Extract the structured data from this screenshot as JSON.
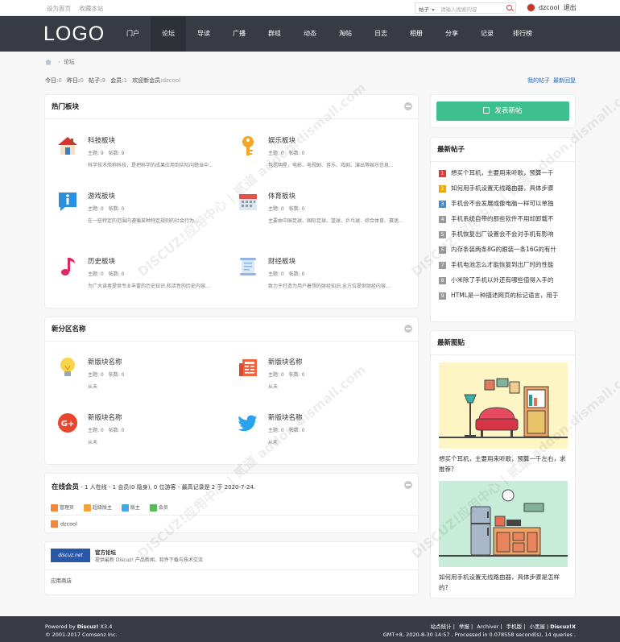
{
  "topbar": {
    "set_home": "设为首页",
    "bookmark": "收藏本站"
  },
  "search": {
    "scope": "帖子",
    "placeholder": "请输入搜索内容"
  },
  "user": {
    "name": "dzcool",
    "logout": "退出"
  },
  "logo": "LOGO",
  "nav": [
    "门户",
    "论坛",
    "导读",
    "广播",
    "群组",
    "动态",
    "淘帖",
    "日志",
    "相册",
    "分享",
    "记录",
    "排行榜"
  ],
  "breadcrumb": {
    "current": "论坛"
  },
  "stats": {
    "today_label": "今日:",
    "today": "0",
    "yesterday_label": "昨日:",
    "yesterday": "0",
    "posts_label": "帖子:",
    "posts": "9",
    "members_label": "会员:",
    "members": "1",
    "welcome_label": "欢迎新会员:",
    "newest": "dzcool"
  },
  "my_links": {
    "my_posts": "我的帖子",
    "latest": "最新回复"
  },
  "hot": {
    "title": "热门板块",
    "forums": [
      {
        "name": "科技板块",
        "topics": "主题: 9",
        "posts": "帖数: 9",
        "desc": "科学技术简称科技，是把科学的成果应用到实际问题当中..."
      },
      {
        "name": "娱乐板块",
        "topics": "主题: 0",
        "posts": "帖数: 0",
        "desc": "包括明星，电影、电视剧、音乐、戏剧、演出等娱乐信息..."
      },
      {
        "name": "游戏板块",
        "topics": "主题: 0",
        "posts": "帖数: 0",
        "desc": "在一些特定的范围内遵循某种特定规则的社会行为..."
      },
      {
        "name": "体育板块",
        "topics": "主题: 0",
        "posts": "帖数: 0",
        "desc": "主要由中国足球、国际足球、篮球、乒乓球、综合体育、赛迷..."
      },
      {
        "name": "历史板块",
        "topics": "主题: 0",
        "posts": "帖数: 0",
        "desc": "为广大读者提供专业丰富的历史知识,和活性的历史内容..."
      },
      {
        "name": "财经板块",
        "topics": "主题: 0",
        "posts": "帖数: 0",
        "desc": "致力于打造为用户着想的财经知识,全方位提供财经内容..."
      }
    ]
  },
  "newzone": {
    "title": "新分区名称",
    "forums": [
      {
        "name": "新版块名称",
        "topics": "主题: 0",
        "posts": "帖数: 0",
        "desc": "从未"
      },
      {
        "name": "新版块名称",
        "topics": "主题: 0",
        "posts": "帖数: 0",
        "desc": "从未"
      },
      {
        "name": "新版块名称",
        "topics": "主题: 0",
        "posts": "帖数: 0",
        "desc": "从未"
      },
      {
        "name": "新版块名称",
        "topics": "主题: 0",
        "posts": "帖数: 0",
        "desc": "从未"
      }
    ]
  },
  "online": {
    "title": "在线会员",
    "summary": " - 1 人在线 - 1 会员(0 隐身), 0 位游客 - 最高记录是 2 于 2020-7-24.",
    "legend": [
      "管理员",
      "超级版主",
      "版主",
      "会员"
    ],
    "legend_colors": [
      "#f0883e",
      "#f0a33e",
      "#45a8e6",
      "#5cb85c"
    ],
    "user": "dzcool"
  },
  "friend_links": {
    "logo_text": "discuz.net",
    "name": "官方论坛",
    "desc": "提供最新 Discuz! 产品新闻、软件下载与技术交流",
    "app": "应用商店"
  },
  "sidebar": {
    "new_post": "发表新帖",
    "hot_title": "最新帖子",
    "hot_posts": [
      "想买个耳机，主要用来听歌，预算一千",
      "如何用手机设置无线路由器，具体步骤",
      "手机会不会发展成像电脑一样可以单独",
      "手机系统自带的那些软件不用却卸载不",
      "手机恢复出厂设置会不会对手机有影响",
      "内存条装两条8G的跟装一条16G的有什",
      "手机电池怎么才能恢复到出厂时的性能",
      "小米除了手机以外还有哪些值得入手的",
      "HTML是一种描述网页的标记语言，用于"
    ],
    "pic_title": "最新图贴",
    "pics": [
      {
        "caption": "想买个耳机，主要用来听歌，预算一千左右，求推荐?"
      },
      {
        "caption": "如何用手机设置无线路由器，具体步骤是怎样的?"
      }
    ]
  },
  "footer": {
    "powered": "Powered by ",
    "brand": "Discuz!",
    "version": " X3.4",
    "copyright": "© 2001-2017 Comsenz Inc.",
    "links": [
      "站点统计",
      "举报",
      "Archiver",
      "手机版",
      "小黑屋",
      "Discuz!X"
    ],
    "debug": "GMT+8, 2020-8-30 14:57 , Processed in 0.078558 second(s), 14 queries ."
  },
  "watermark": "DISCUZ!应用中心 | 贰道 addon.dismall.com"
}
